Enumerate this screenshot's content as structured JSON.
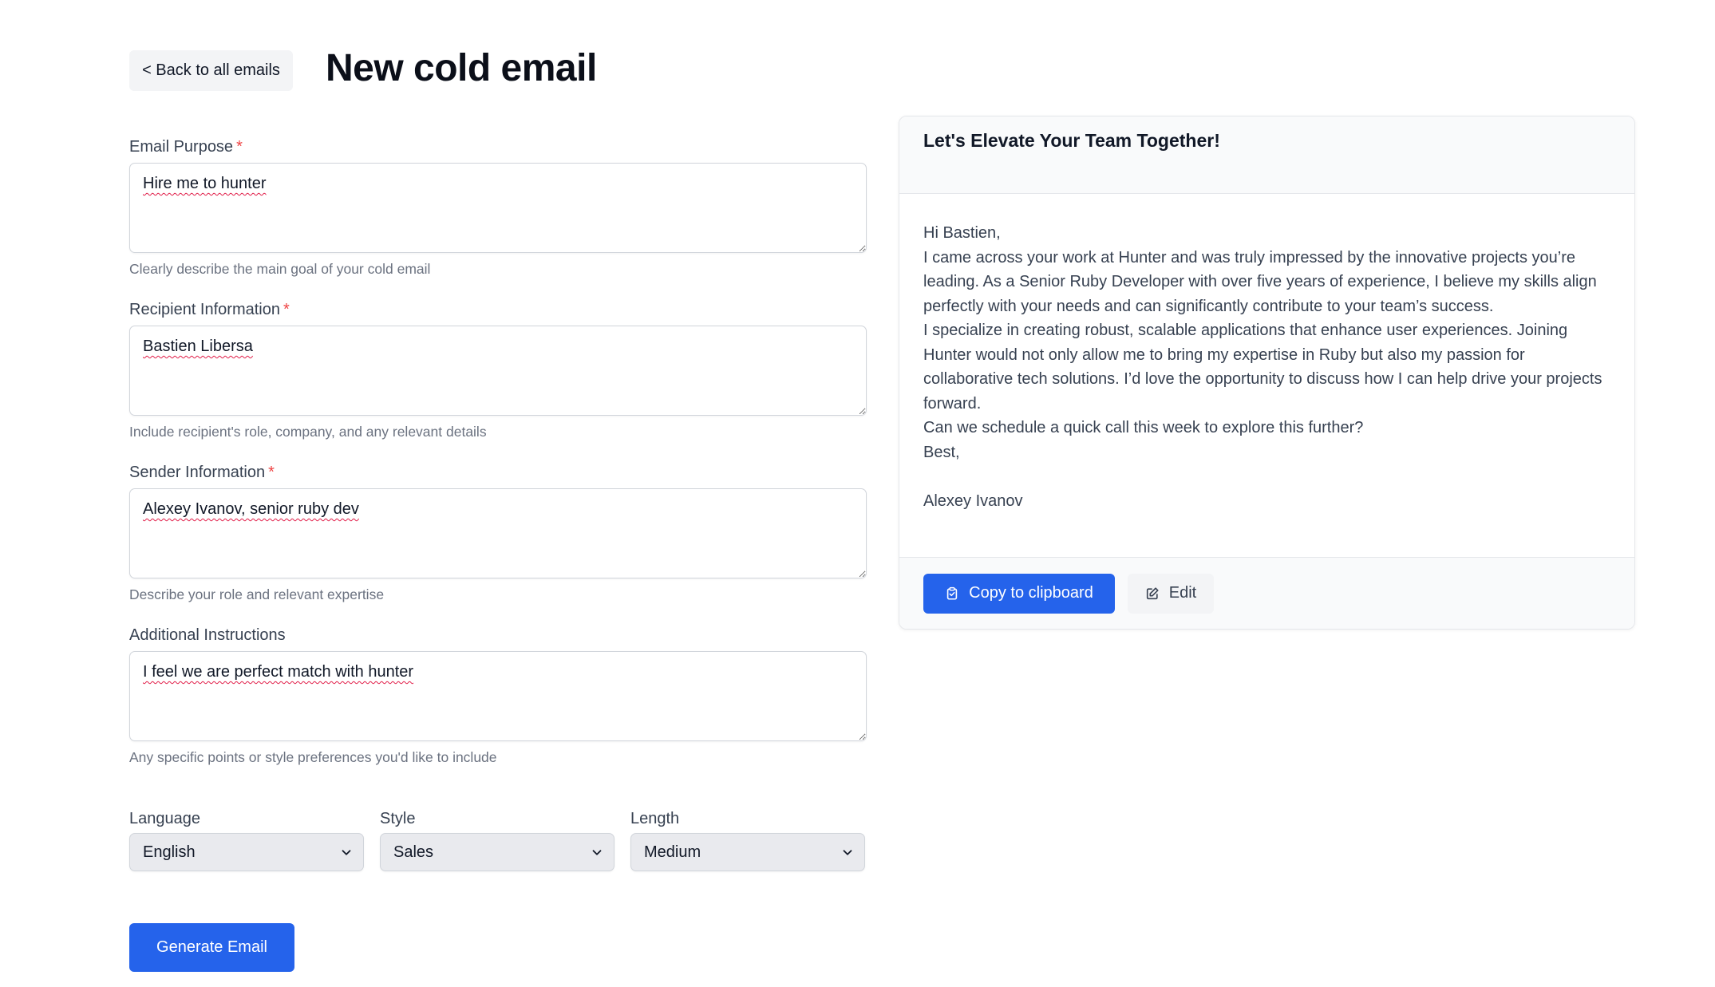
{
  "header": {
    "back_label": "< Back to all emails",
    "title": "New cold email"
  },
  "form": {
    "email_purpose": {
      "label": "Email Purpose",
      "required": "*",
      "value": "Hire me to hunter",
      "hint": "Clearly describe the main goal of your cold email"
    },
    "recipient": {
      "label": "Recipient Information",
      "required": "*",
      "value": "Bastien Libersa",
      "hint": "Include recipient's role, company, and any relevant details"
    },
    "sender": {
      "label": "Sender Information",
      "required": "*",
      "value": "Alexey Ivanov, senior ruby dev",
      "hint": "Describe your role and relevant expertise"
    },
    "additional": {
      "label": "Additional Instructions",
      "value": "I feel we are perfect match with hunter",
      "hint": "Any specific points or style preferences you'd like to include"
    },
    "language": {
      "label": "Language",
      "selected": "English"
    },
    "style": {
      "label": "Style",
      "selected": "Sales"
    },
    "length": {
      "label": "Length",
      "selected": "Medium"
    },
    "generate_label": "Generate Email"
  },
  "preview": {
    "subject": "Let's Elevate Your Team Together!",
    "body": {
      "greeting": "Hi Bastien,",
      "p1": "I came across your work at Hunter and was truly impressed by the innovative projects you’re leading. As a Senior Ruby Developer with over five years of experience, I believe my skills align perfectly with your needs and can significantly contribute to your team’s success.",
      "p2": "I specialize in creating robust, scalable applications that enhance user experiences. Joining Hunter would not only allow me to bring my expertise in Ruby but also my passion for collaborative tech solutions. I’d love the opportunity to discuss how I can help drive your projects forward.",
      "p3": "Can we schedule a quick call this week to explore this further?",
      "closing": "Best,",
      "signature": "Alexey Ivanov"
    },
    "copy_label": "Copy to clipboard",
    "edit_label": "Edit"
  },
  "colors": {
    "primary": "#2563eb",
    "required": "#ef4444",
    "hint": "#6b7280"
  },
  "icons": [
    "chevron-down-icon",
    "clipboard-icon",
    "edit-icon"
  ]
}
